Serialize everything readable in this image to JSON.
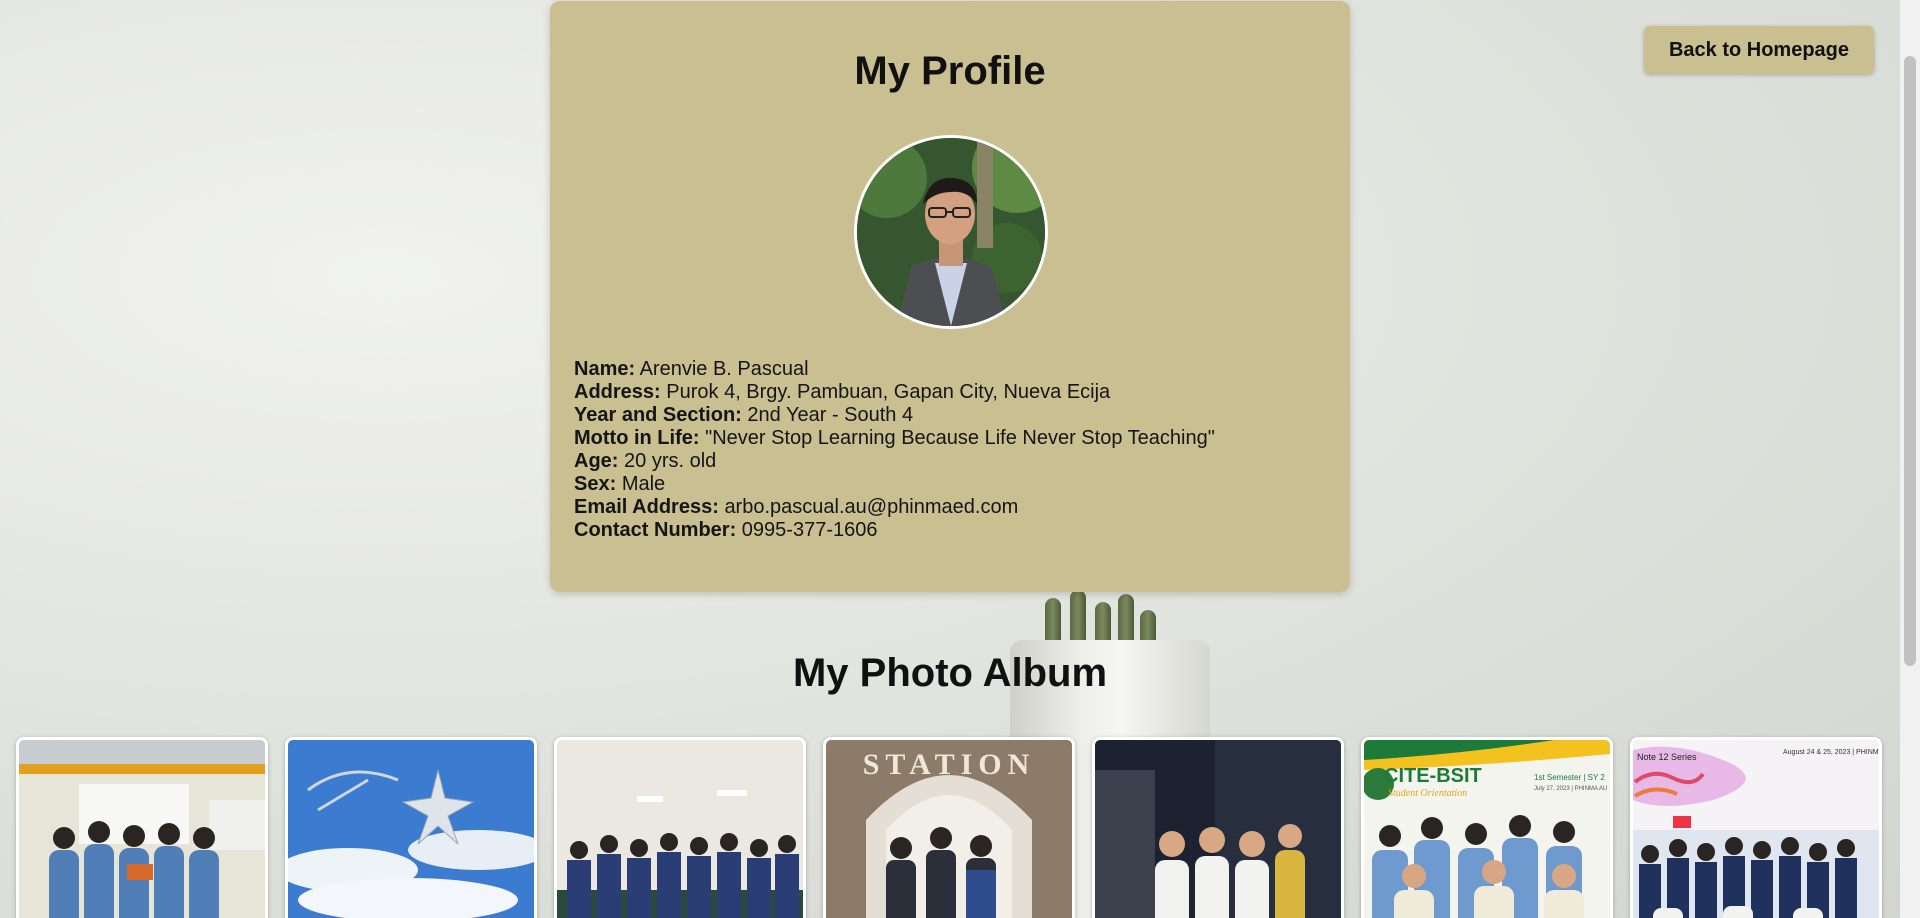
{
  "nav": {
    "back_label": "Back to Homepage"
  },
  "profile": {
    "title": "My Profile",
    "fields": [
      {
        "label": "Name:",
        "value": "Arenvie B. Pascual"
      },
      {
        "label": "Address:",
        "value": "Purok 4, Brgy. Pambuan, Gapan City, Nueva Ecija"
      },
      {
        "label": "Year and Section:",
        "value": "2nd Year - South 4"
      },
      {
        "label": "Motto in Life:",
        "value": "\"Never Stop Learning Because Life Never Stop Teaching\""
      },
      {
        "label": "Age:",
        "value": "20 yrs. old"
      },
      {
        "label": "Sex:",
        "value": "Male"
      },
      {
        "label": "Email Address:",
        "value": "arbo.pascual.au@phinmaed.com"
      },
      {
        "label": "Contact Number:",
        "value": "0995-377-1606"
      }
    ]
  },
  "album": {
    "title": "My Photo Album",
    "photo_texts": {
      "station_sign": "STATION",
      "cite_banner": "CITE-BSIT",
      "cite_subtitle": "Student Orientation",
      "cite_semester": "1st Semester | SY 2",
      "cite_date": "July 27, 2023 | PHINMA AU",
      "note_header": "Note 12 Series",
      "note_date": "August 24 & 25, 2023 | PHINM"
    }
  },
  "colors": {
    "card": "#c9bf91",
    "button": "#c9bf91"
  }
}
